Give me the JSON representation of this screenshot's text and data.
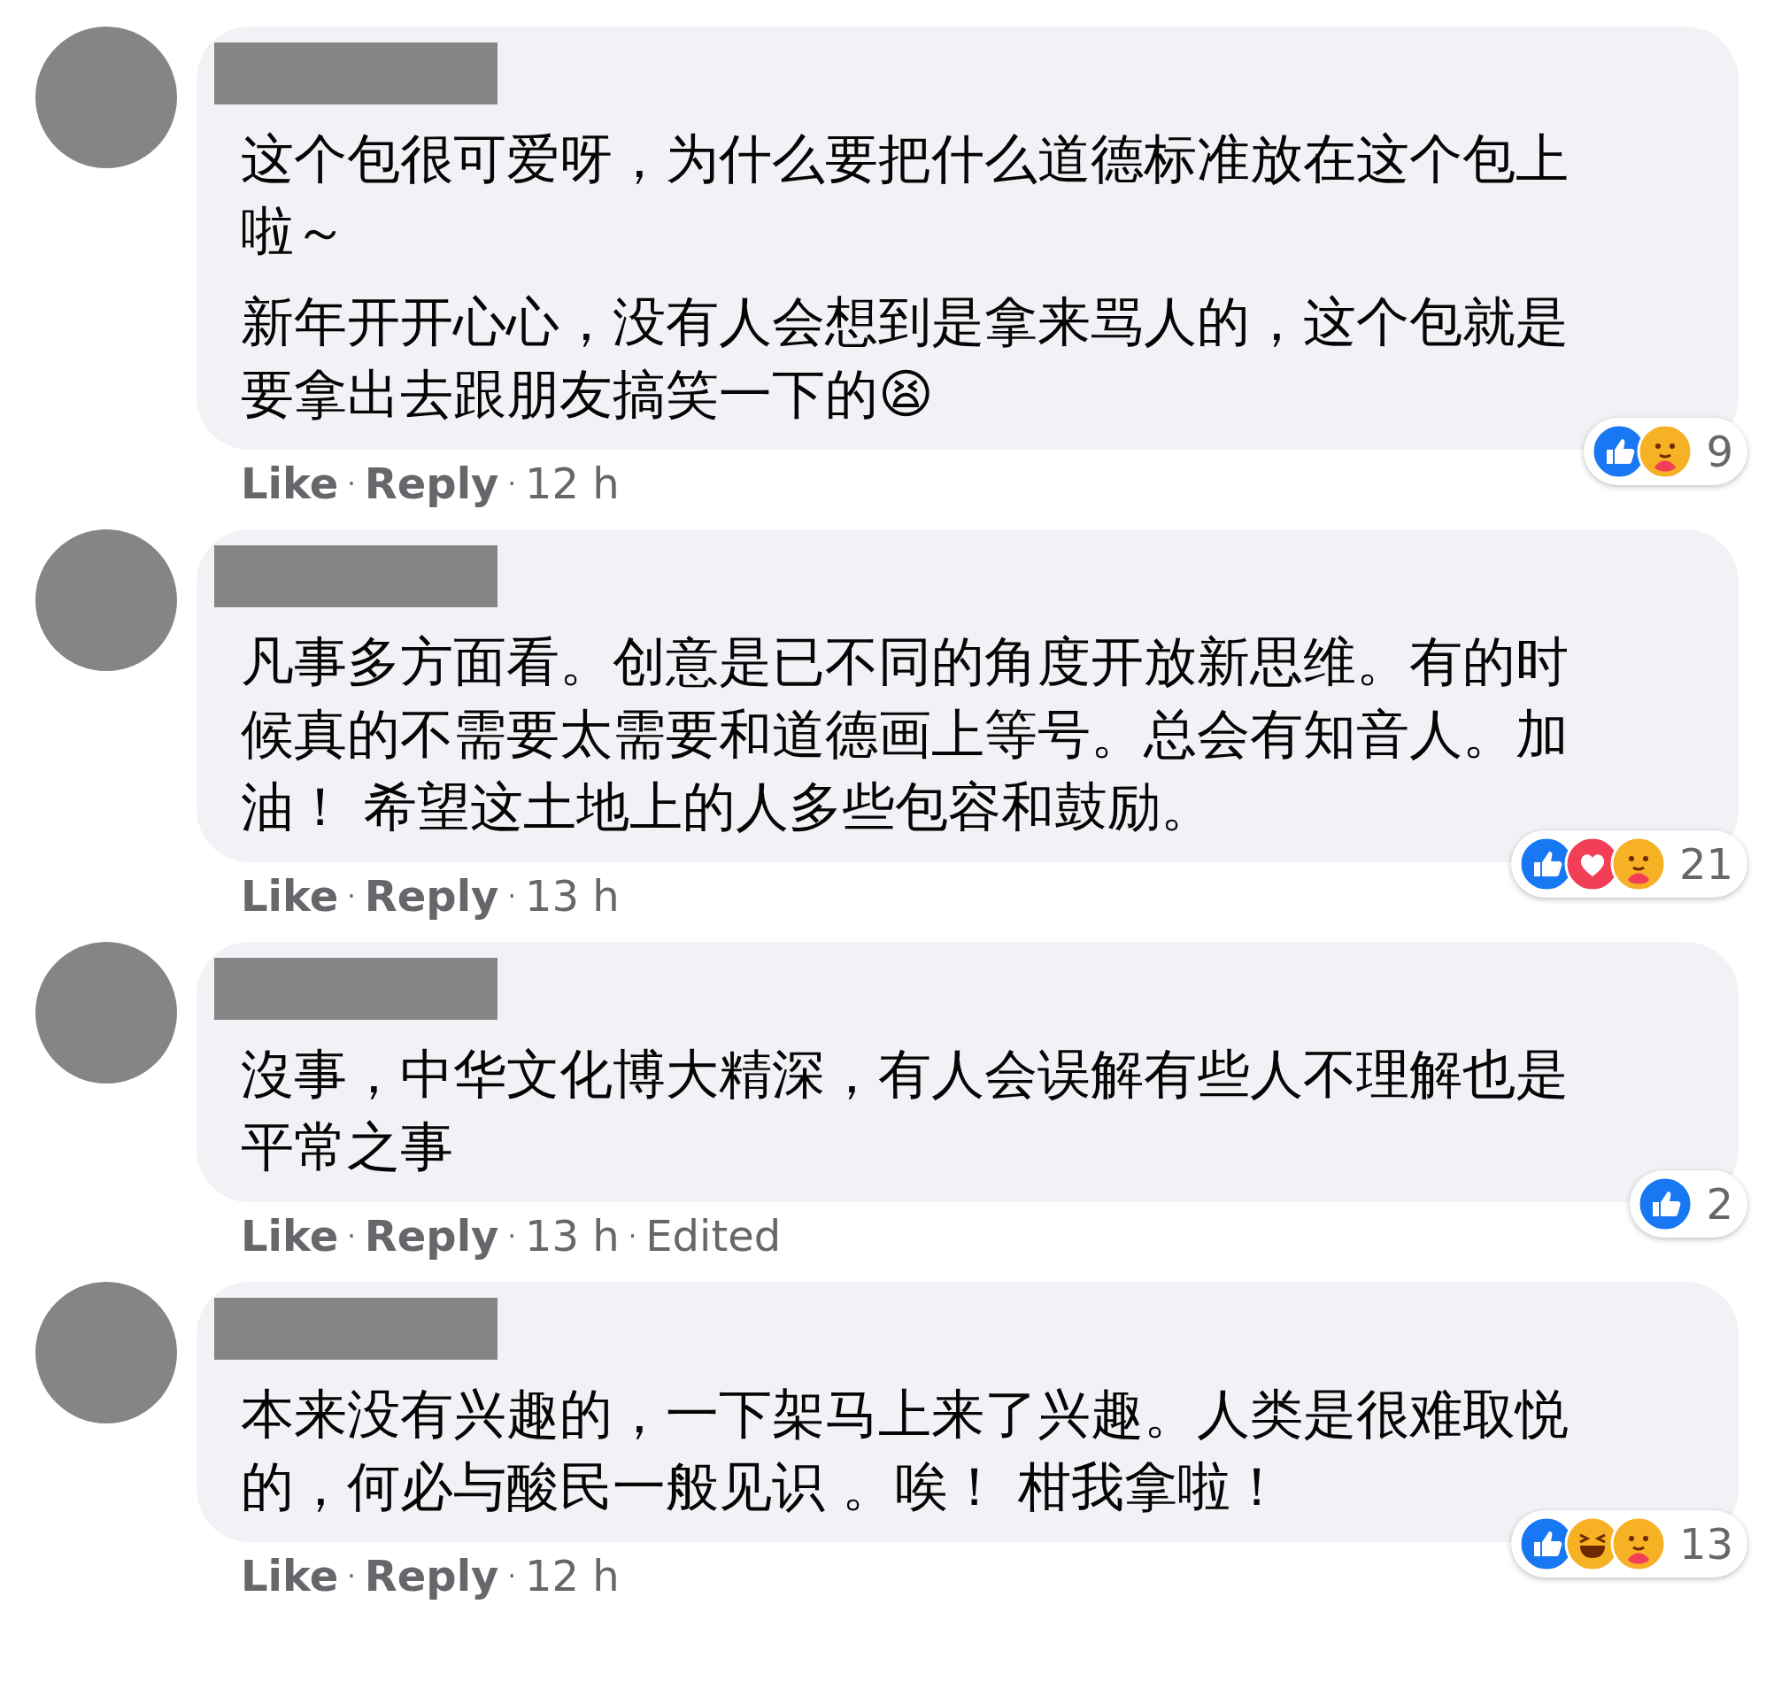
{
  "comments": [
    {
      "paragraphs": [
        "这个包很可爱呀，为什么要把什么道德标准放在这个包上啦～",
        "新年开开心心，没有人会想到是拿来骂人的，这个包就是要拿出去跟朋友搞笑一下的😫"
      ],
      "actions": [
        {
          "kind": "link",
          "text": "Like"
        },
        {
          "kind": "dot",
          "text": "·"
        },
        {
          "kind": "link",
          "text": "Reply"
        },
        {
          "kind": "dot",
          "text": "·"
        },
        {
          "kind": "meta",
          "text": "12 h"
        }
      ],
      "reactions": [
        {
          "kind": "like"
        },
        {
          "kind": "care"
        }
      ],
      "reaction_count": "9"
    },
    {
      "paragraphs": [
        "凡事多方面看。创意是已不同的角度开放新思维。有的时候真的不需要太需要和道德画上等号。总会有知音人。加油！ 希望这土地上的人多些包容和鼓励。"
      ],
      "actions": [
        {
          "kind": "link",
          "text": "Like"
        },
        {
          "kind": "dot",
          "text": "·"
        },
        {
          "kind": "link",
          "text": "Reply"
        },
        {
          "kind": "dot",
          "text": "·"
        },
        {
          "kind": "meta",
          "text": "13 h"
        }
      ],
      "reactions": [
        {
          "kind": "like"
        },
        {
          "kind": "love"
        },
        {
          "kind": "care"
        }
      ],
      "reaction_count": "21"
    },
    {
      "paragraphs": [
        "沒事，中华文化博大精深，有人会误解有些人不理解也是平常之事"
      ],
      "actions": [
        {
          "kind": "link",
          "text": "Like"
        },
        {
          "kind": "dot",
          "text": "·"
        },
        {
          "kind": "link",
          "text": "Reply"
        },
        {
          "kind": "dot",
          "text": "·"
        },
        {
          "kind": "meta",
          "text": "13 h"
        },
        {
          "kind": "dot",
          "text": "·"
        },
        {
          "kind": "meta",
          "text": "Edited"
        }
      ],
      "reactions": [
        {
          "kind": "like"
        }
      ],
      "reaction_count": "2"
    },
    {
      "paragraphs": [
        "本来没有兴趣的，一下架马上来了兴趣。人类是很难取悦的，何必与酸民一般见识 。唉！ 柑我拿啦！"
      ],
      "actions": [
        {
          "kind": "link",
          "text": "Like"
        },
        {
          "kind": "dot",
          "text": "·"
        },
        {
          "kind": "link",
          "text": "Reply"
        },
        {
          "kind": "dot",
          "text": "·"
        },
        {
          "kind": "meta",
          "text": "12 h"
        }
      ],
      "reactions": [
        {
          "kind": "like"
        },
        {
          "kind": "haha"
        },
        {
          "kind": "care"
        }
      ],
      "reaction_count": "13"
    }
  ]
}
